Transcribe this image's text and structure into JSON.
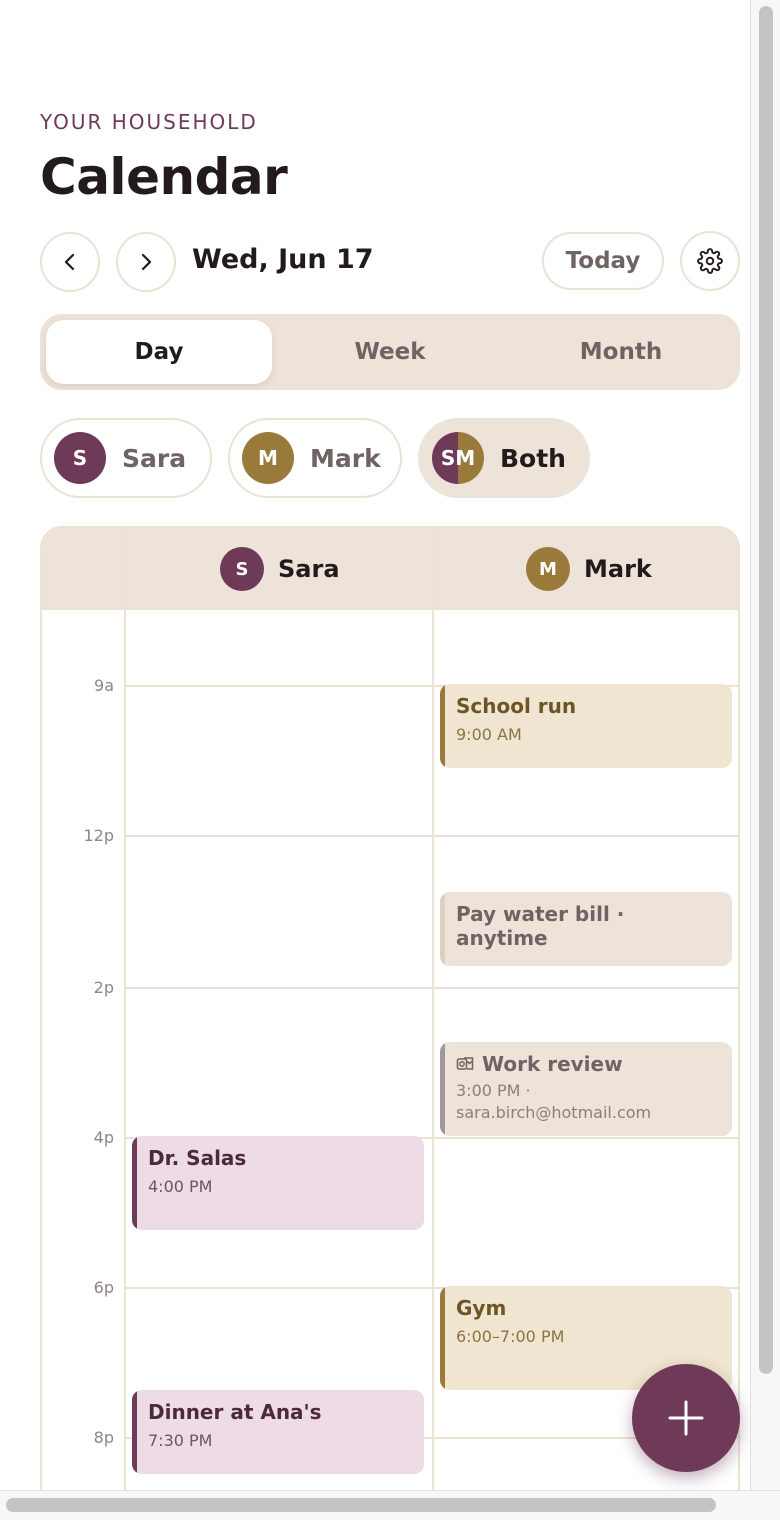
{
  "header": {
    "eyebrow": "YOUR HOUSEHOLD",
    "title": "Calendar"
  },
  "toolbar": {
    "prev_icon": "chevron-left-icon",
    "next_icon": "chevron-right-icon",
    "date": "Wed, Jun 17",
    "today_label": "Today",
    "settings_icon": "gear-icon"
  },
  "views": [
    {
      "label": "Day",
      "active": true
    },
    {
      "label": "Week",
      "active": false
    },
    {
      "label": "Month",
      "active": false
    }
  ],
  "people_filter": [
    {
      "initials": "S",
      "label": "Sara",
      "color": "#6e3a58",
      "active": false
    },
    {
      "initials": "M",
      "label": "Mark",
      "color": "#9a7a3a",
      "active": false
    },
    {
      "initials": "SM",
      "label": "Both",
      "active": true
    }
  ],
  "columns": [
    {
      "initials": "S",
      "name": "Sara",
      "color": "#6e3a58"
    },
    {
      "initials": "M",
      "name": "Mark",
      "color": "#9a7a3a"
    }
  ],
  "time_labels": [
    "9a",
    "12p",
    "2p",
    "4p",
    "6p",
    "8p"
  ],
  "events": {
    "mark": [
      {
        "title": "School run",
        "sub": "9:00 AM"
      },
      {
        "title": "Pay water bill · anytime"
      },
      {
        "title": "Work review",
        "icon": "outlook-icon",
        "sub": "3:00 PM · sara.birch@hotmail.com"
      },
      {
        "title": "Gym",
        "sub": "6:00–7:00 PM"
      }
    ],
    "sara": [
      {
        "title": "Dr. Salas",
        "sub": "4:00 PM"
      },
      {
        "title": "Dinner at Ana's",
        "sub": "7:30 PM"
      }
    ]
  },
  "fab": {
    "icon": "plus-icon"
  },
  "colors": {
    "plum": "#6e3a58",
    "gold": "#9a7a3a",
    "beige": "#ede3d8",
    "border": "#ece1d4"
  }
}
